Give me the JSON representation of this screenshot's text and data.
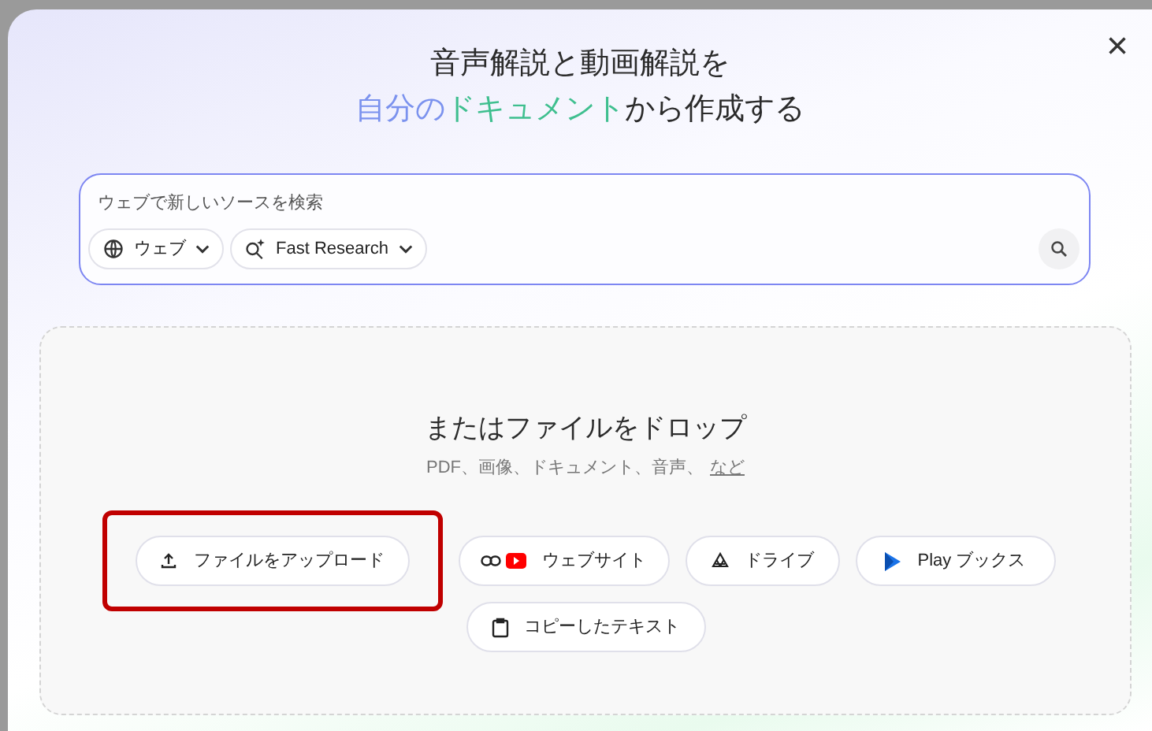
{
  "dialog": {
    "title_line_1": "音声解説と動画解説を",
    "title_line_2": [
      {
        "text": "自分の",
        "color": "#7b92ee"
      },
      {
        "text": "ドキュメント",
        "color": "#3fbf8f"
      },
      {
        "text": "から作成する",
        "color": "#2b2b2b"
      }
    ],
    "close": "×"
  },
  "search": {
    "placeholder": "ウェブで新しいソースを検索",
    "chips": [
      {
        "kind": "globe",
        "label": "ウェブ"
      },
      {
        "kind": "research",
        "label": "Fast Research"
      }
    ]
  },
  "drop_zone": {
    "heading": "またはファイルをドロップ",
    "formats": "PDF、画像、ドキュメント、音声、",
    "more_link": "など",
    "sources": [
      {
        "kind": "upload",
        "label": "ファイルをアップロード",
        "highlighted": true
      },
      {
        "kind": "website",
        "label": "ウェブサイト",
        "highlighted": false
      },
      {
        "kind": "drive",
        "label": "ドライブ",
        "highlighted": false
      },
      {
        "kind": "books",
        "label": "Play ブックス",
        "highlighted": false
      },
      {
        "kind": "clipboard",
        "label": "コピーしたテキスト",
        "highlighted": false
      }
    ]
  }
}
